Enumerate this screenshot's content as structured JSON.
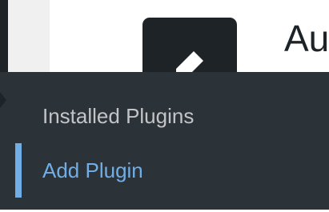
{
  "plugin_header": {
    "title": "Au",
    "icon": "pencil-icon"
  },
  "submenu": {
    "items": [
      {
        "label": "Installed Plugins",
        "active": false
      },
      {
        "label": "Add Plugin",
        "active": true
      }
    ]
  },
  "colors": {
    "admin_dark": "#1d2327",
    "flyout_bg": "#2c3338",
    "submenu_text": "#c3c4c7",
    "accent": "#72aee6",
    "page_bg": "#f0f0f1"
  }
}
